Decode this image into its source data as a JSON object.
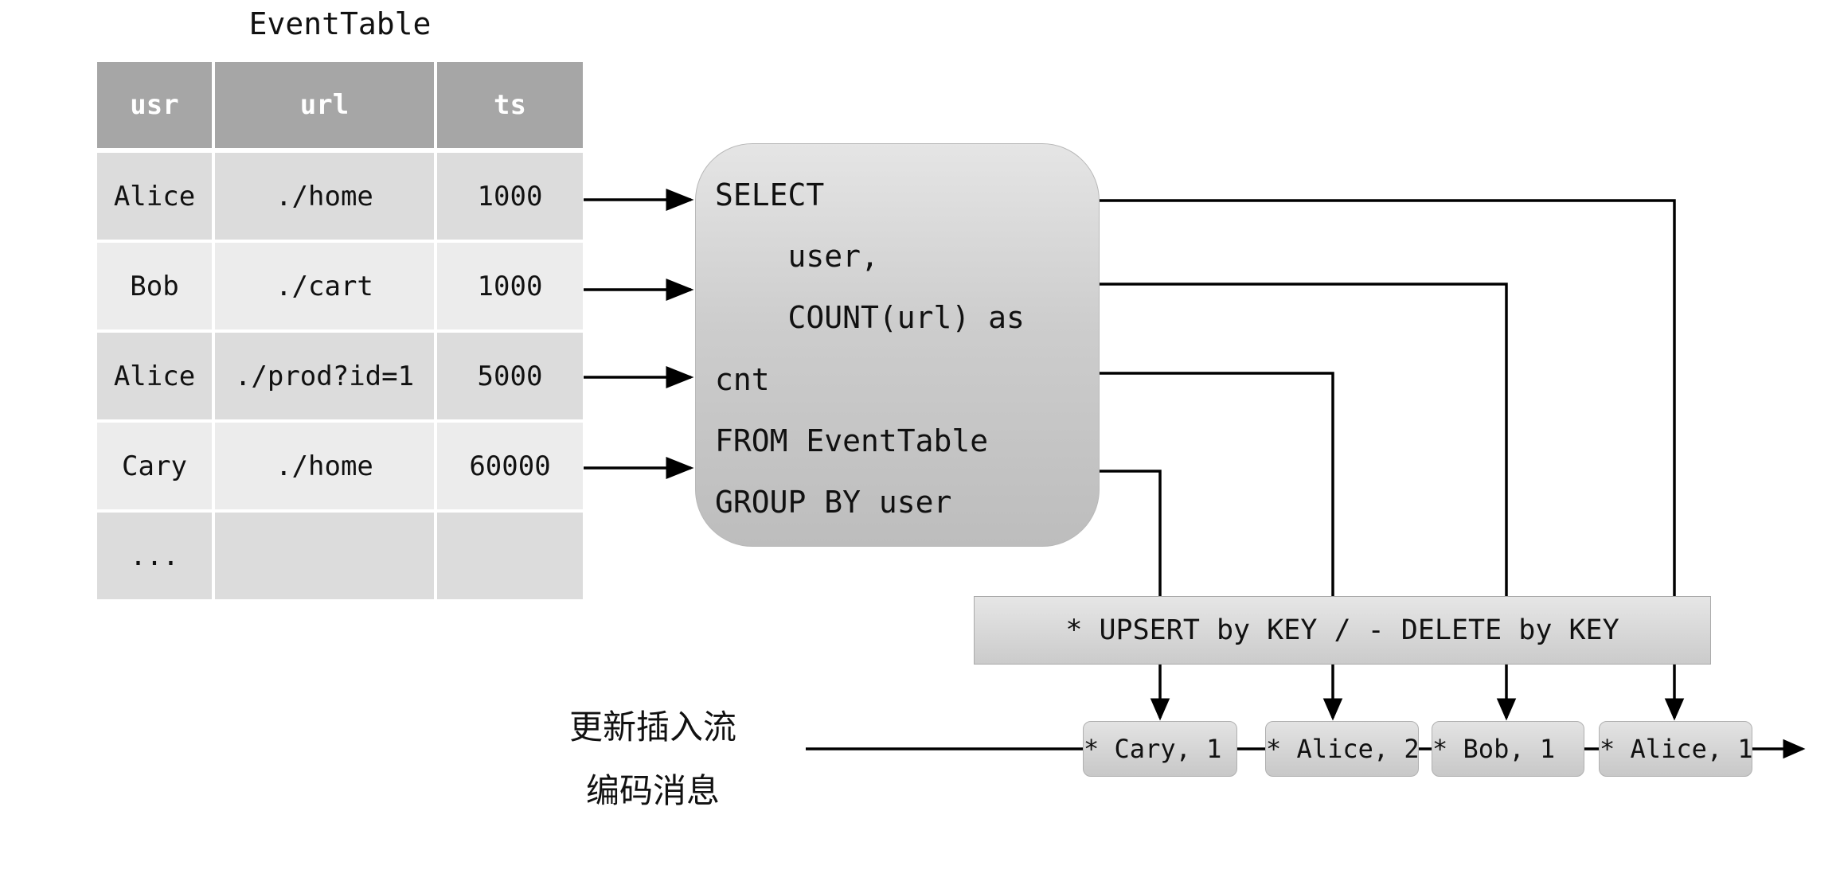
{
  "table": {
    "title": "EventTable",
    "headers": [
      "usr",
      "url",
      "ts"
    ],
    "rows": [
      [
        "Alice",
        "./home",
        "1000"
      ],
      [
        "Bob",
        "./cart",
        "1000"
      ],
      [
        "Alice",
        "./prod?id=1",
        "5000"
      ],
      [
        "Cary",
        "./home",
        "60000"
      ],
      [
        "...",
        "",
        ""
      ]
    ]
  },
  "sql": {
    "lines": [
      "SELECT",
      "    user,",
      "    COUNT(url) as",
      "cnt",
      "FROM EventTable",
      "GROUP BY user"
    ]
  },
  "upsert_label": "* UPSERT by KEY / - DELETE by KEY",
  "stream": {
    "messages": [
      "* Cary, 1",
      "* Alice, 2",
      "* Bob, 1",
      "* Alice, 1"
    ],
    "caption_line1": "更新插入流",
    "caption_line2": "编码消息"
  }
}
